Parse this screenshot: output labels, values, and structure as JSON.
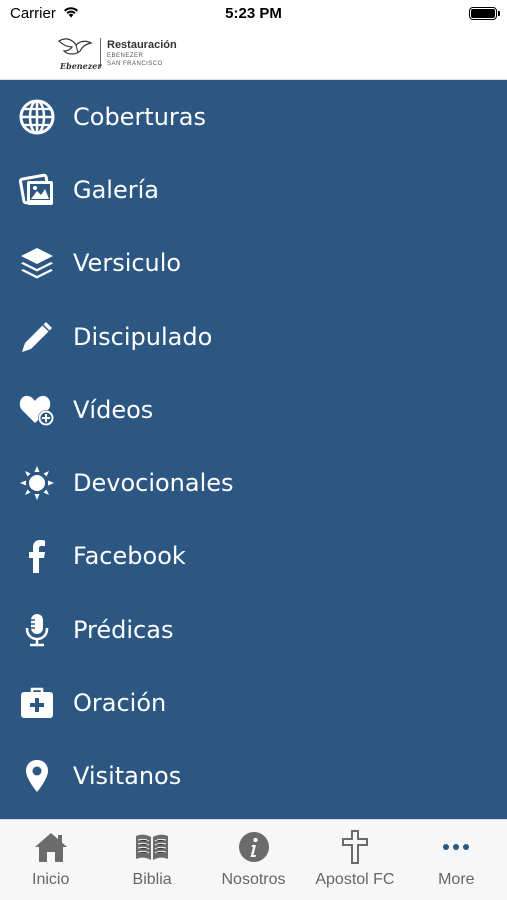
{
  "status_bar": {
    "carrier": "Carrier",
    "time": "5:23 PM"
  },
  "header": {
    "logo_title": "Restauración",
    "logo_line1": "EBENEZER",
    "logo_line2": "SAN FRANCISCO",
    "logo_mark_text": "Ebenezer"
  },
  "menu": {
    "background": "#2c5782",
    "items": [
      {
        "label": "Coberturas",
        "icon": "globe-icon"
      },
      {
        "label": "Galería",
        "icon": "photo-gallery-icon"
      },
      {
        "label": "Versiculo",
        "icon": "layers-icon"
      },
      {
        "label": "Discipulado",
        "icon": "pencil-icon"
      },
      {
        "label": "Vídeos",
        "icon": "heart-plus-icon"
      },
      {
        "label": "Devocionales",
        "icon": "sun-icon"
      },
      {
        "label": "Facebook",
        "icon": "facebook-icon"
      },
      {
        "label": "Prédicas",
        "icon": "microphone-icon"
      },
      {
        "label": "Oración",
        "icon": "first-aid-kit-icon"
      },
      {
        "label": "Visitanos",
        "icon": "location-pin-icon"
      }
    ]
  },
  "tab_bar": {
    "tabs": [
      {
        "label": "Inicio",
        "icon": "home-icon"
      },
      {
        "label": "Biblia",
        "icon": "book-icon"
      },
      {
        "label": "Nosotros",
        "icon": "info-icon"
      },
      {
        "label": "Apostol FC",
        "icon": "cross-icon"
      },
      {
        "label": "More",
        "icon": "more-icon"
      }
    ],
    "more_color": "#2c5782"
  }
}
